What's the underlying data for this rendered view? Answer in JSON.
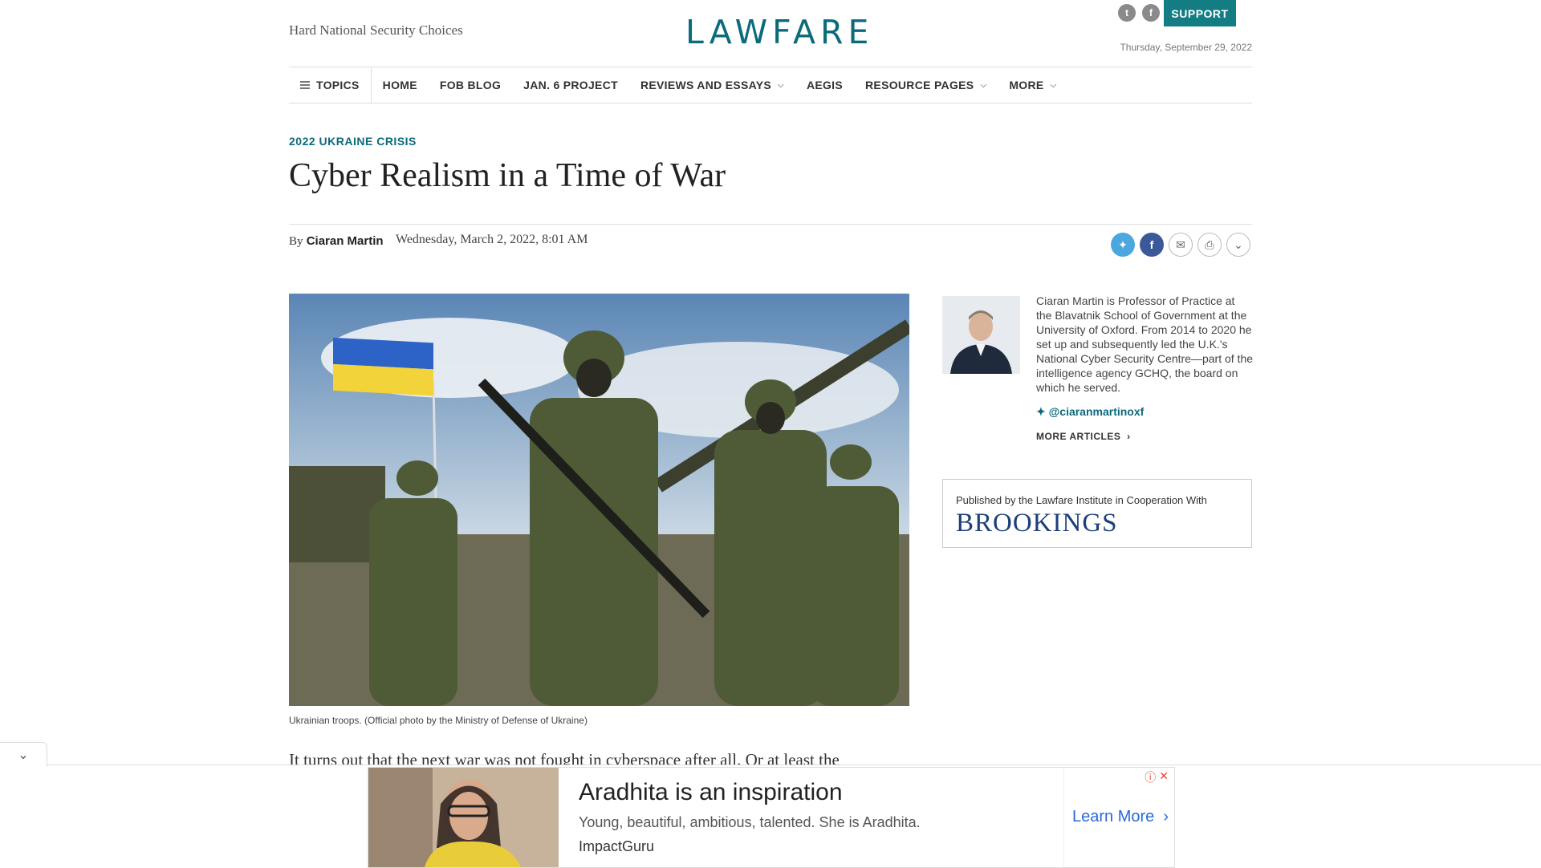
{
  "header": {
    "tagline": "Hard National Security Choices",
    "logo": "LAWFARE",
    "support_label": "SUPPORT",
    "date": "Thursday, September 29, 2022",
    "social": [
      {
        "icon": "twitter-icon",
        "glyph": "t"
      },
      {
        "icon": "facebook-icon",
        "glyph": "f"
      }
    ]
  },
  "nav": {
    "topics": "TOPICS",
    "items": [
      {
        "label": "HOME",
        "dropdown": false
      },
      {
        "label": "FOB BLOG",
        "dropdown": false
      },
      {
        "label": "JAN. 6 PROJECT",
        "dropdown": false
      },
      {
        "label": "REVIEWS AND ESSAYS",
        "dropdown": true
      },
      {
        "label": "AEGIS",
        "dropdown": false
      },
      {
        "label": "RESOURCE PAGES",
        "dropdown": true
      },
      {
        "label": "MORE",
        "dropdown": true
      }
    ]
  },
  "article": {
    "kicker": "2022 UKRAINE CRISIS",
    "title": "Cyber Realism in a Time of War",
    "by": "By",
    "author": "Ciaran Martin",
    "date": "Wednesday, March 2, 2022, 8:01 AM",
    "caption": "Ukrainian troops. (Official photo by the Ministry of Defense of Ukraine)",
    "body_first_line": "It turns out that the next war was not fought in cyberspace after all. Or at least the"
  },
  "author_box": {
    "bio": "Ciaran Martin is Professor of Practice at the Blavatnik School of Government at the University of Oxford. From 2014 to 2020 he set up and subsequently led the U.K.'s National Cyber Security Centre—part of the intelligence agency GCHQ, the board on which he served.",
    "twitter": "@ciaranmartinoxf",
    "more": "MORE ARTICLES"
  },
  "brookings": {
    "pre": "Published by the Lawfare Institute in Cooperation With",
    "logo": "BROOKINGS"
  },
  "ad": {
    "title": "Aradhita is an inspiration",
    "desc": "Young, beautiful, ambitious, talented. She is Aradhita.",
    "source": "ImpactGuru",
    "cta": "Learn More"
  },
  "colors": {
    "accent": "#0b6a7b",
    "support": "#137d83",
    "brookings": "#1c3f7a"
  }
}
